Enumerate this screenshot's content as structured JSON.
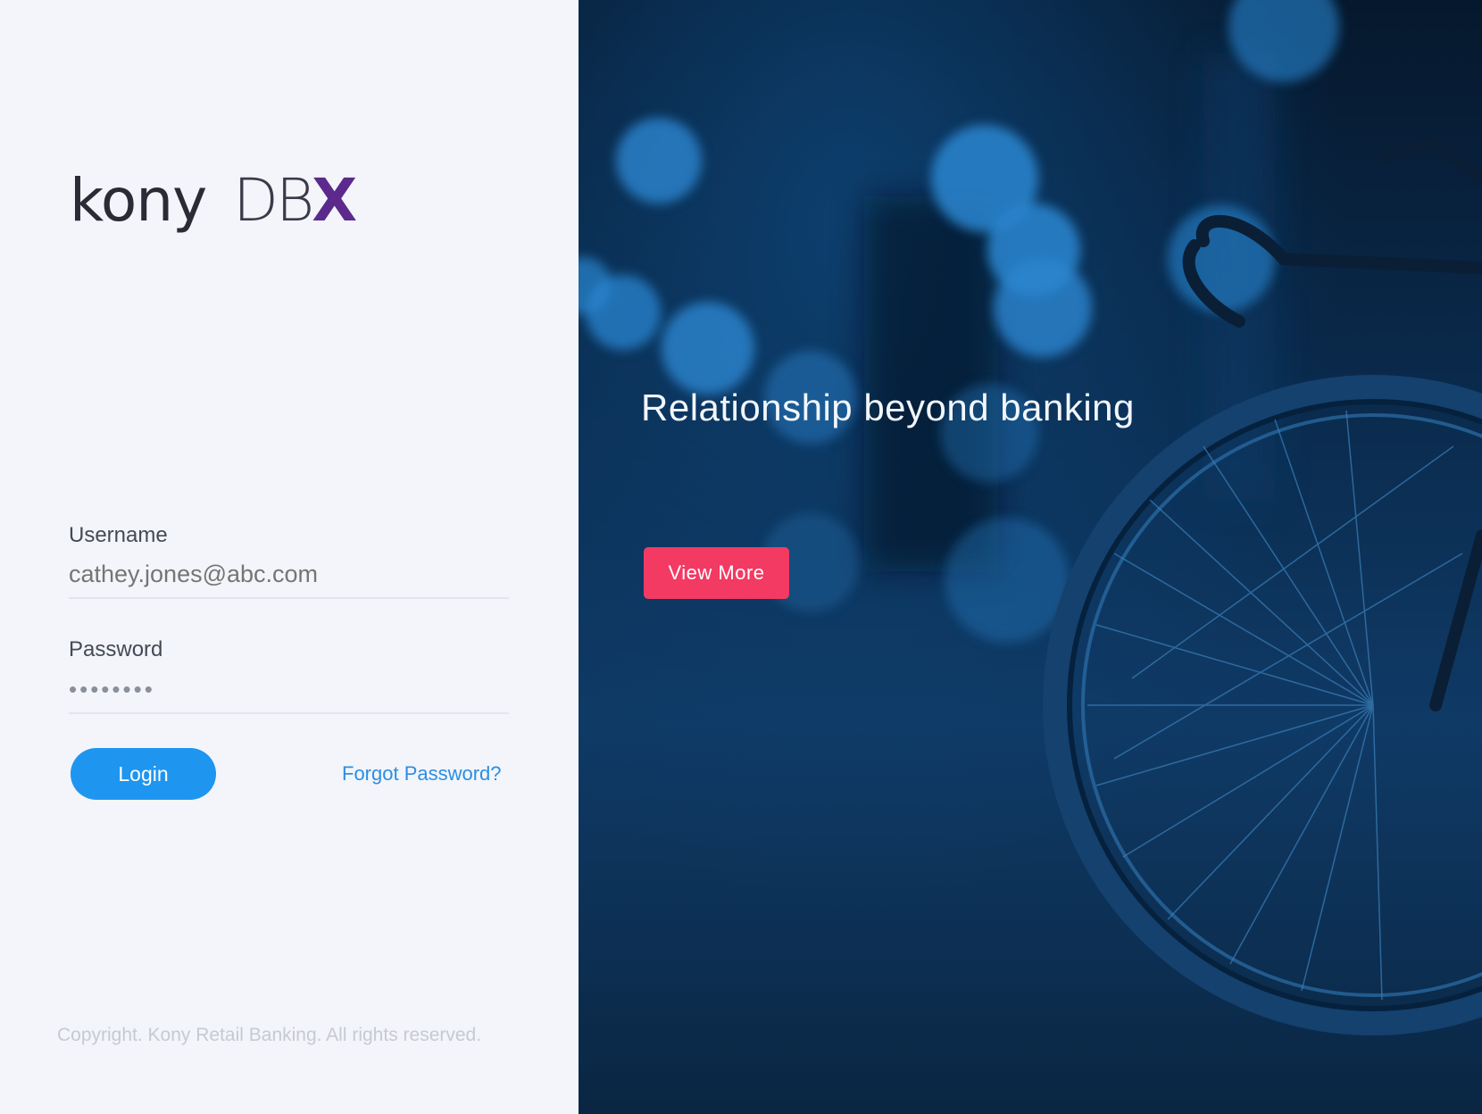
{
  "brand": {
    "name_primary": "kony",
    "name_secondary_main": "DB",
    "name_secondary_accent": "X"
  },
  "login_form": {
    "username_label": "Username",
    "username_placeholder": "cathey.jones@abc.com",
    "password_label": "Password",
    "password_value": "••••••••",
    "login_label": "Login",
    "forgot_label": "Forgot Password?"
  },
  "footer": {
    "copyright": "Copyright. Kony Retail Banking. All rights reserved."
  },
  "hero": {
    "tagline": "Relationship beyond banking",
    "cta_label": "View More"
  },
  "colors": {
    "primary_button": "#1e96f0",
    "link": "#2a8ee6",
    "cta_button": "#f23a63",
    "brand_accent": "#5b2a8c",
    "left_panel_bg": "#f3f5fa",
    "hero_bg": "#0a2a4c"
  }
}
